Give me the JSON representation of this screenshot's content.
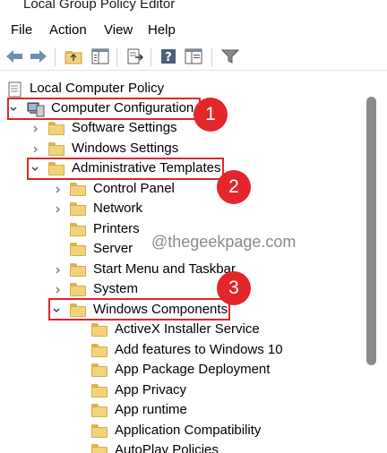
{
  "window": {
    "title": "Local Group Policy Editor"
  },
  "menu": {
    "file": "File",
    "action": "Action",
    "view": "View",
    "help": "Help"
  },
  "toolbar": {
    "icons": [
      "back-arrow-icon",
      "forward-arrow-icon",
      "up-folder-icon",
      "show-hide-tree-icon",
      "export-list-icon",
      "help-icon",
      "properties-icon",
      "filter-icon"
    ]
  },
  "tree": {
    "root": "Local Computer Policy",
    "computer_configuration": "Computer Configuration",
    "software_settings": "Software Settings",
    "windows_settings": "Windows Settings",
    "administrative_templates": "Administrative Templates",
    "control_panel": "Control Panel",
    "network": "Network",
    "printers": "Printers",
    "server": "Server",
    "start_menu": "Start Menu and Taskbar",
    "system": "System",
    "windows_components": "Windows Components",
    "activex": "ActiveX Installer Service",
    "add_features": "Add features to Windows 10",
    "app_package": "App Package Deployment",
    "app_privacy": "App Privacy",
    "app_runtime": "App runtime",
    "app_compat": "Application Compatibility",
    "autoplay": "AutoPlay Policies"
  },
  "annotations": {
    "step1": "1",
    "step2": "2",
    "step3": "3",
    "accent": "#e3262a"
  },
  "watermark": "@thegeekpage.com"
}
